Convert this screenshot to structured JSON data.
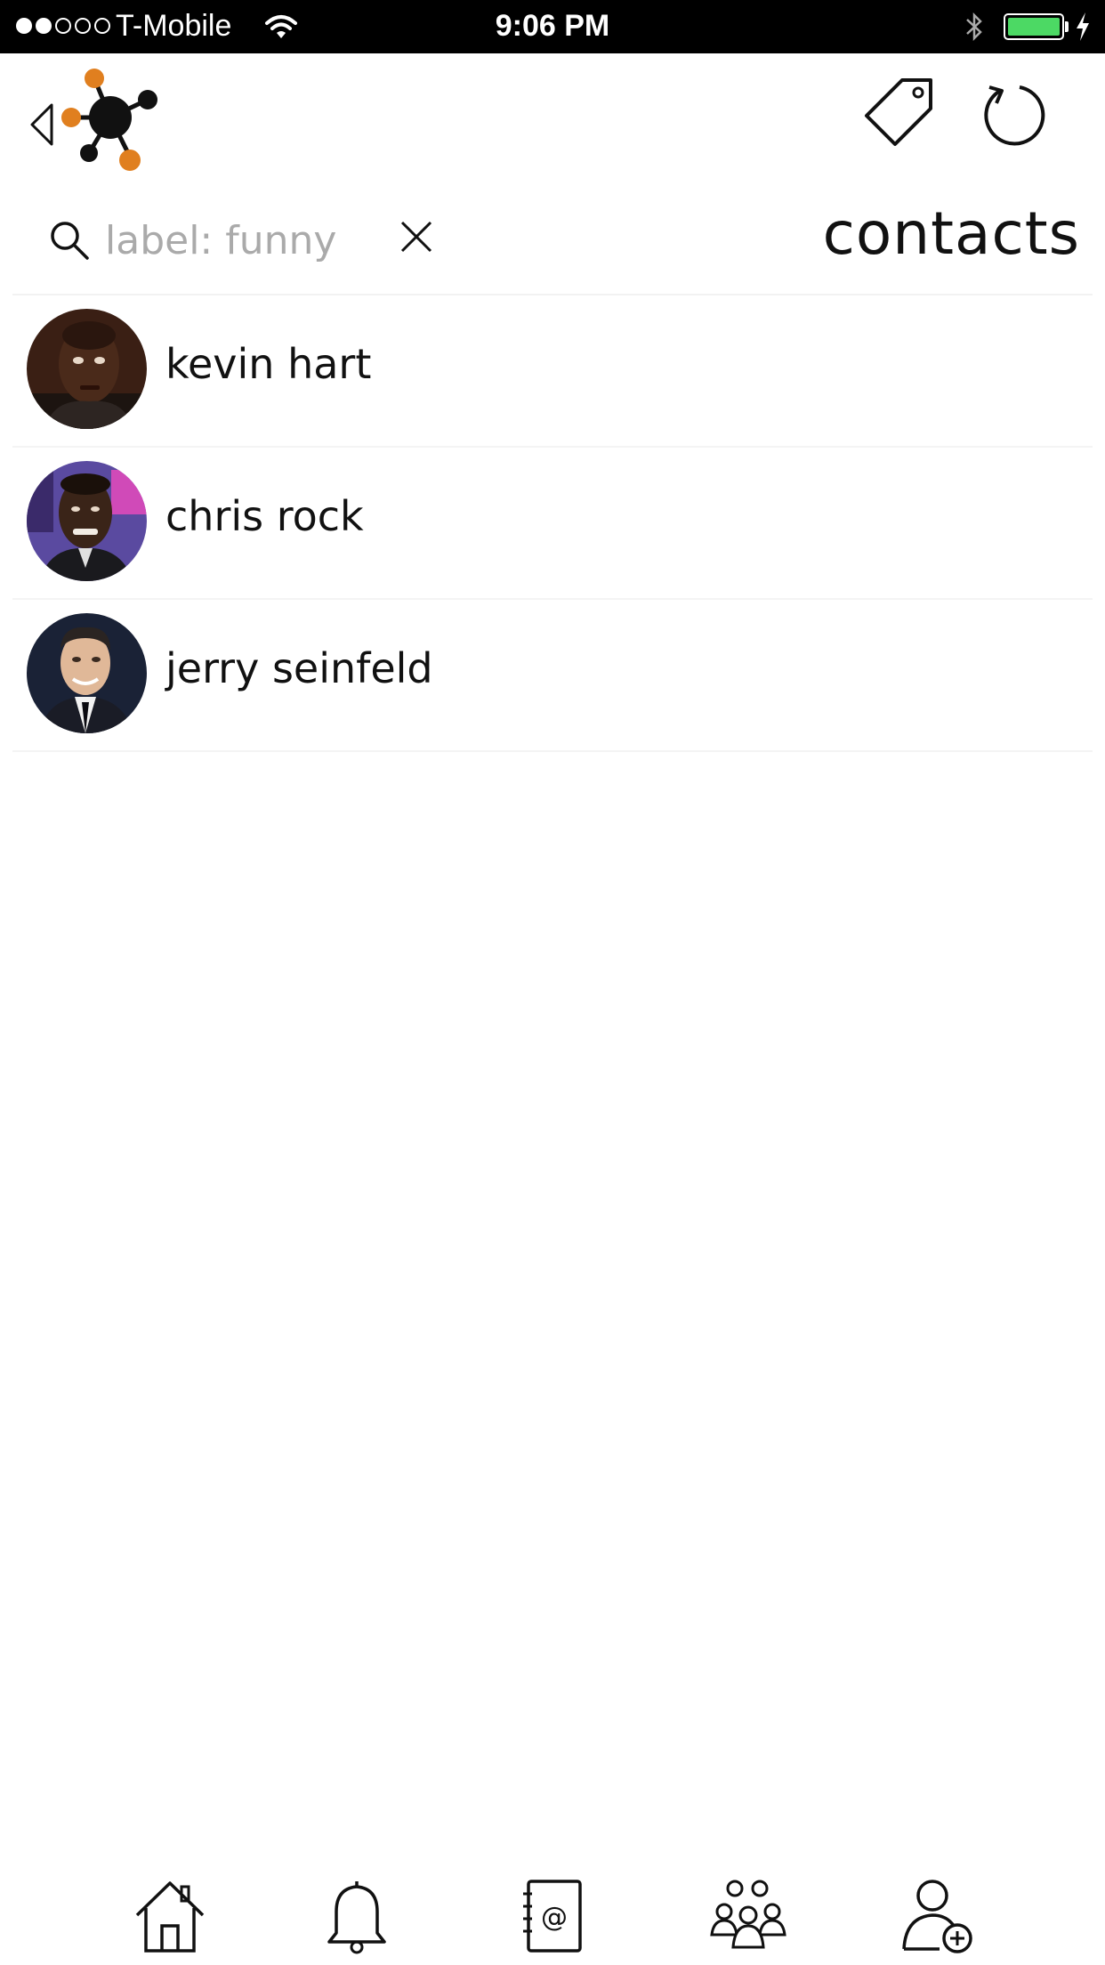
{
  "status_bar": {
    "carrier": "T-Mobile",
    "time": "9:06 PM",
    "signal_strength": 2,
    "battery_color": "#4cd964"
  },
  "header": {
    "logo_colors": {
      "node_primary": "#111111",
      "node_accent": "#e07f1f"
    }
  },
  "search": {
    "placeholder": "label: funny",
    "value": ""
  },
  "page": {
    "title": "contacts"
  },
  "contacts": [
    {
      "name": "kevin hart"
    },
    {
      "name": "chris rock"
    },
    {
      "name": "jerry seinfeld"
    }
  ],
  "bottom_nav": {
    "items": [
      "home-icon",
      "bell-icon",
      "address-book-icon",
      "group-icon",
      "add-user-icon"
    ]
  }
}
